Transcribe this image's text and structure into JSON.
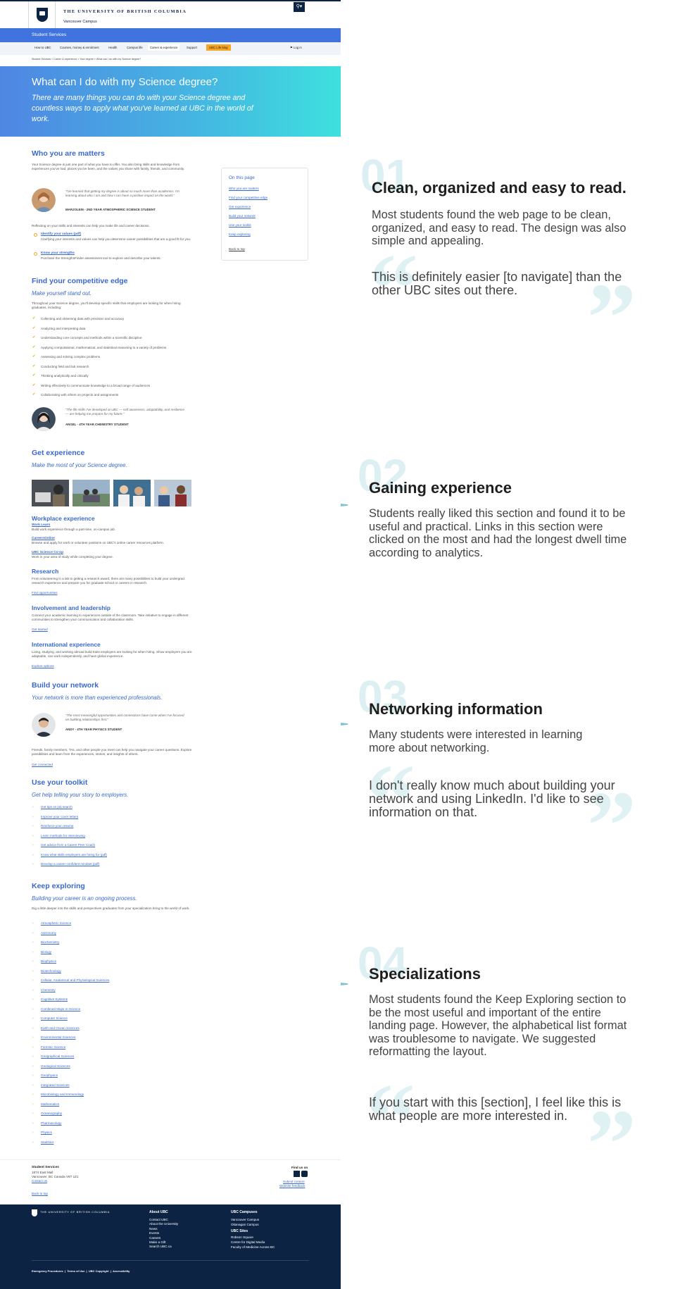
{
  "header": {
    "university": "THE UNIVERSITY OF BRITISH COLUMBIA",
    "campus": "Vancouver Campus",
    "unit": "Student Services",
    "login": "Log in"
  },
  "nav": [
    "How to UBC",
    "Courses, money & enrolment",
    "Health",
    "Campus life",
    "Career & experience",
    "Support",
    "UBC Life blog"
  ],
  "breadcrumb": "Student Services > Career & experience > Your degree > What can I do with my Science degree?",
  "hero": {
    "title": "What can I do with my Science degree?",
    "lead": "There are many things you can do with your Science degree and countless ways to apply what you've learned at UBC in the world of work."
  },
  "who": {
    "title": "Who you are matters",
    "intro": "Your Science degree is just one part of what you have to offer. You also bring skills and knowledge from experiences you've had, places you've been, and the values you share with family, friends, and community.",
    "quote": "\"I've learned that getting my degree is about so much more than academics. I'm learning about who I am and how I can have a positive impact on the world.\"",
    "quote_name": "MARJOLEIN - 2ND YEAR ATMOSPHERIC SCIENCE STUDENT",
    "reflect": "Reflecting on your skills and interests can help you make life and career decisions.",
    "items": [
      {
        "link": "Identify your values (pdf)",
        "text": "Clarifying your interests and values can help you determine career possibilities that are a good fit for you."
      },
      {
        "link": "Know your strengths",
        "text": "Purchase the StrengthsFinder assessment tool to explore and describe your talents."
      }
    ]
  },
  "onpage": {
    "title": "On this page",
    "links": [
      "Who you are matters",
      "Find your competitive edge",
      "Get experience",
      "Build your network",
      "Use your toolkit",
      "Keep exploring"
    ],
    "back": "Back to top"
  },
  "edge": {
    "title": "Find your competitive edge",
    "sub": "Make yourself stand out.",
    "intro": "Throughout your Science degree, you'll develop specific skills that employers are looking for when hiring graduates, including:",
    "skills": [
      "Collecting and observing data with precision and accuracy",
      "Analyzing and interpreting data",
      "Understanding core concepts and methods within a scientific discipline",
      "Applying computational, mathematical, and statistical reasoning to a variety of problems",
      "Assessing and solving complex problems",
      "Conducting field and lab research",
      "Thinking analytically and critically",
      "Writing effectively to communicate knowledge to a broad range of audiences",
      "Collaborating with others on projects and assignments"
    ],
    "quote": "\"The life skills I've developed at UBC — self awareness, adaptability, and resilience — are helping me prepare for my future.\"",
    "quote_name": "ANGEL - 4TH YEAR CHEMISTRY STUDENT"
  },
  "exp": {
    "title": "Get experience",
    "sub": "Make the most of your Science degree.",
    "workplace": "Workplace experience",
    "work_items": [
      {
        "link": "Work Learn",
        "text": "Build work experience through a part-time, on-campus job."
      },
      {
        "link": "CareersOnline",
        "text": "Browse and apply for work or volunteer positions on UBC's online career resources platform."
      },
      {
        "link": "UBC Science Co-op",
        "text": "Work in your area of study while completing your degree."
      }
    ],
    "research": "Research",
    "research_text": "From volunteering in a lab to getting a research award, there are many possibilities to build your undergrad research experience and prepare you for graduate school or careers in research.",
    "research_link": "Find opportunities",
    "involve": "Involvement and leadership",
    "involve_text": "Connect your academic learning to experiences outside of the classroom. Take initiative to engage in different communities to strengthen your communication and collaboration skills.",
    "involve_link": "Get started",
    "intl": "International experience",
    "intl_text": "Living, studying, and working abroad build traits employers are looking for when hiring. Show employers you are adaptable, can work independently, and have global experience.",
    "intl_link": "Explore options"
  },
  "network": {
    "title": "Build your network",
    "sub": "Your network is more than experienced professionals.",
    "quote": "\"The most meaningful opportunities and connections have come when I've focused on building relationships first.\"",
    "quote_name": "ANDY - 4TH YEAR PHYSICS STUDENT",
    "text": "Friends, family members, TAs, and other people you meet can help you navigate your career questions. Explore possibilities and learn from the experiences, stories, and insights of others.",
    "link": "Get connected"
  },
  "toolkit": {
    "title": "Use your toolkit",
    "sub": "Get help telling your story to employers.",
    "links": [
      "Get tips on job search",
      "Improve your cover letters",
      "Reinforce your resume",
      "Learn methods for interviewing",
      "Get advice from a Career Peer Coach",
      "Know what skills employers are hiring for (pdf)",
      "Develop a career-confident mindset (pdf)"
    ]
  },
  "explore": {
    "title": "Keep exploring",
    "sub": "Building your career is an ongoing process.",
    "intro": "Dig a little deeper into the skills and perspectives graduates from your specialization bring to the world of work.",
    "links": [
      "Atmospheric Science",
      "Astronomy",
      "Biochemistry",
      "Biology",
      "Biophysics",
      "Biotechnology",
      "Cellular, Anatomical and Physiological Sciences",
      "Chemistry",
      "Cognitive Systems",
      "Combined Major in Science",
      "Computer Science",
      "Earth and Ocean Sciences",
      "Environmental Sciences",
      "Forensic Science",
      "Geographical Sciences",
      "Geological Sciences",
      "Geophysics",
      "Integrated Sciences",
      "Microbiology and Immunology",
      "Mathematics",
      "Oceanography",
      "Pharmacology",
      "Physics",
      "Statistics"
    ]
  },
  "footer": {
    "unit": "Student Services",
    "addr1": "1874 East Mall",
    "addr2": "Vancouver, BC Canada V6T 1Z1",
    "contact": "Contact us",
    "find": "Find us on",
    "submit": "Submit content",
    "feedback": "Website feedback",
    "back": "Back to top",
    "about_title": "About UBC",
    "about": [
      "Contact UBC",
      "About the University",
      "News",
      "Events",
      "Careers",
      "Make a Gift",
      "Search UBC.ca"
    ],
    "campuses_title": "UBC Campuses",
    "campuses": [
      "Vancouver Campus",
      "Okanagan Campus"
    ],
    "sites_title": "UBC Sites",
    "sites": [
      "Robson Square",
      "Centre for Digital Media",
      "Faculty of Medicine Across BC"
    ],
    "legal": "Emergency Procedures  |  Terms of Use  |  UBC Copyright  |  Accessibility"
  },
  "notes": [
    {
      "num": "01",
      "title": "Clean, organized and easy to read.",
      "body": "Most students found the web page to be clean, organized, and easy to read. The design was also simple and appealing.",
      "quote": "This is definitely easier [to navigate] than the other UBC sites out there."
    },
    {
      "num": "02",
      "title": "Gaining experience",
      "body": "Students really liked this section and found it to be useful and practical. Links in this section were clicked on the most and had the longest dwell time according to analytics."
    },
    {
      "num": "03",
      "title": "Networking information",
      "body": "Many students were interested in learning more about networking.",
      "quote": "I don't really know much about building your network and using LinkedIn. I'd like to see information on that."
    },
    {
      "num": "04",
      "title": "Specializations",
      "body": "Most students found the Keep Exploring section to be the most useful and important of the entire landing page. However, the alphabetical list format was troublesome to navigate. We suggested reformatting the layout.",
      "quote": "If you start with this [section], I feel like this is what people are more interested in."
    }
  ],
  "colors": {
    "ubc_navy": "#0c2344",
    "accent_blue": "#3a69cc",
    "service_bar": "#4073de",
    "bracket": "#7cc3cd",
    "bullet": "#e6a823"
  }
}
